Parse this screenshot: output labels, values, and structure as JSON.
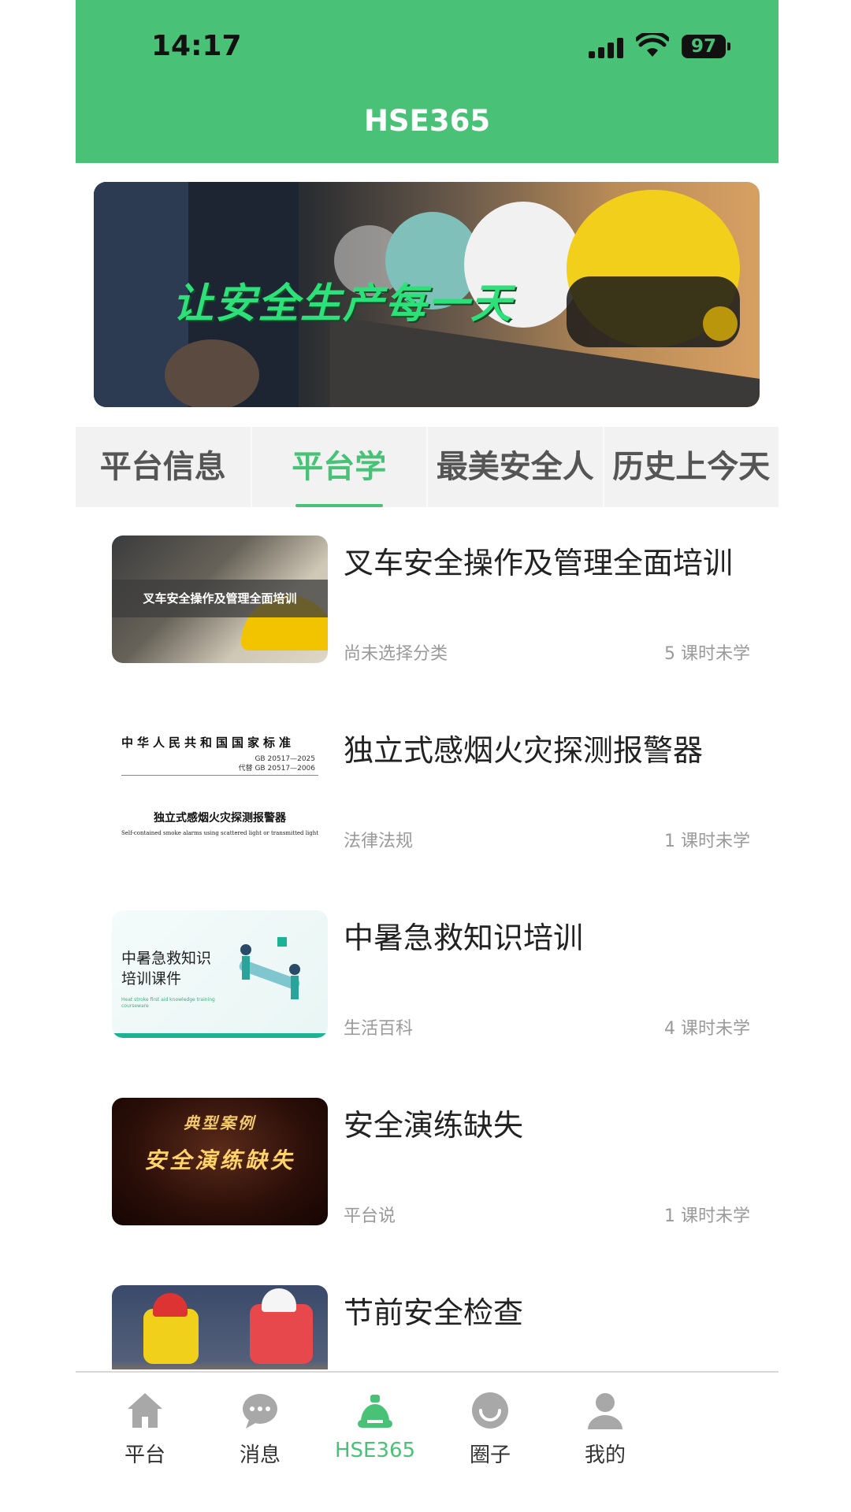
{
  "status_bar": {
    "time": "14:17",
    "battery": "97"
  },
  "header": {
    "title": "HSE365"
  },
  "banner": {
    "text": "让安全生产每一天"
  },
  "tabs": [
    {
      "label": "平台信息"
    },
    {
      "label": "平台学"
    },
    {
      "label": "最美安全人"
    },
    {
      "label": "历史上今天"
    }
  ],
  "active_tab": "平台学",
  "courses": [
    {
      "title": "叉车安全操作及管理全面培训",
      "category": "尚未选择分类",
      "lessons": "5 课时未学",
      "thumb": {
        "overlay": "叉车安全操作及管理全面培训"
      }
    },
    {
      "title": "独立式感烟火灾探测报警器",
      "category": "法律法规",
      "lessons": "1 课时未学",
      "thumb": {
        "line1": "中华人民共和国国家标准",
        "line2a": "GB 20517—2025",
        "line2b": "代替 GB 20517—2006",
        "line3": "独立式感烟火灾探测报警器",
        "line4": "Self-contained smoke alarms using scattered light or transmitted light"
      }
    },
    {
      "title": "中暑急救知识培训",
      "category": "生活百科",
      "lessons": "4 课时未学",
      "thumb": {
        "line1a": "中暑急救知识",
        "line1b": "培训课件",
        "line2": "Heat stroke first aid knowledge training courseware"
      }
    },
    {
      "title": "安全演练缺失",
      "category": "平台说",
      "lessons": "1 课时未学",
      "thumb": {
        "line1": "典型案例",
        "line2": "安全演练缺失"
      }
    },
    {
      "title": "节前安全检查",
      "category": "",
      "lessons": "",
      "thumb": {}
    }
  ],
  "bottom_nav": [
    {
      "label": "平台",
      "icon": "home-icon"
    },
    {
      "label": "消息",
      "icon": "message-icon"
    },
    {
      "label": "HSE365",
      "icon": "hse-icon"
    },
    {
      "label": "圈子",
      "icon": "circle-icon"
    },
    {
      "label": "我的",
      "icon": "profile-icon"
    }
  ],
  "colors": {
    "brand": "#49c177",
    "text": "#222222",
    "muted": "#9a9a9a"
  }
}
